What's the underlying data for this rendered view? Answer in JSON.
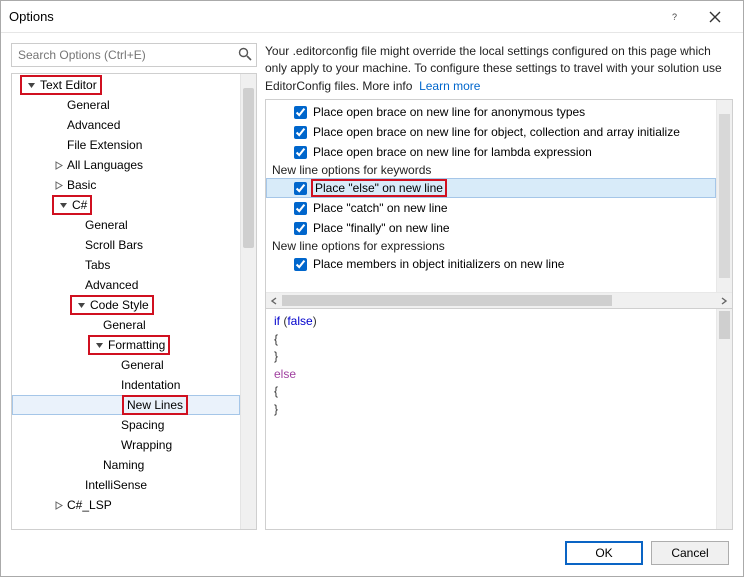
{
  "window": {
    "title": "Options"
  },
  "search": {
    "placeholder": "Search Options (Ctrl+E)"
  },
  "tree": {
    "text_editor": "Text Editor",
    "general": "General",
    "advanced": "Advanced",
    "file_extension": "File Extension",
    "all_languages": "All Languages",
    "basic": "Basic",
    "csharp": "C#",
    "scroll_bars": "Scroll Bars",
    "tabs": "Tabs",
    "code_style": "Code Style",
    "formatting": "Formatting",
    "indentation": "Indentation",
    "new_lines": "New Lines",
    "spacing": "Spacing",
    "wrapping": "Wrapping",
    "naming": "Naming",
    "intellisense": "IntelliSense",
    "csharp_lsp": "C#_LSP"
  },
  "info": {
    "text": "Your .editorconfig file might override the local settings configured on this page which only apply to your machine. To configure these settings to travel with your solution use EditorConfig files. More info",
    "learn_more": "Learn more"
  },
  "options": {
    "g1_anon": "Place open brace on new line for anonymous types",
    "g1_obj": "Place open brace on new line for object, collection and array initialize",
    "g1_lambda": "Place open brace on new line for lambda expression",
    "g2_head": "New line options for keywords",
    "g2_else": "Place \"else\" on new line",
    "g2_catch": "Place \"catch\" on new line",
    "g2_finally": "Place \"finally\" on new line",
    "g3_head": "New line options for expressions",
    "g3_members": "Place members in object initializers on new line"
  },
  "preview": {
    "l1a": "if",
    "l1b": " (",
    "l1c": "false",
    "l1d": ")",
    "l2": "{",
    "l3": "}",
    "l4": "else",
    "l5": "{",
    "l6": "}"
  },
  "buttons": {
    "ok": "OK",
    "cancel": "Cancel"
  }
}
